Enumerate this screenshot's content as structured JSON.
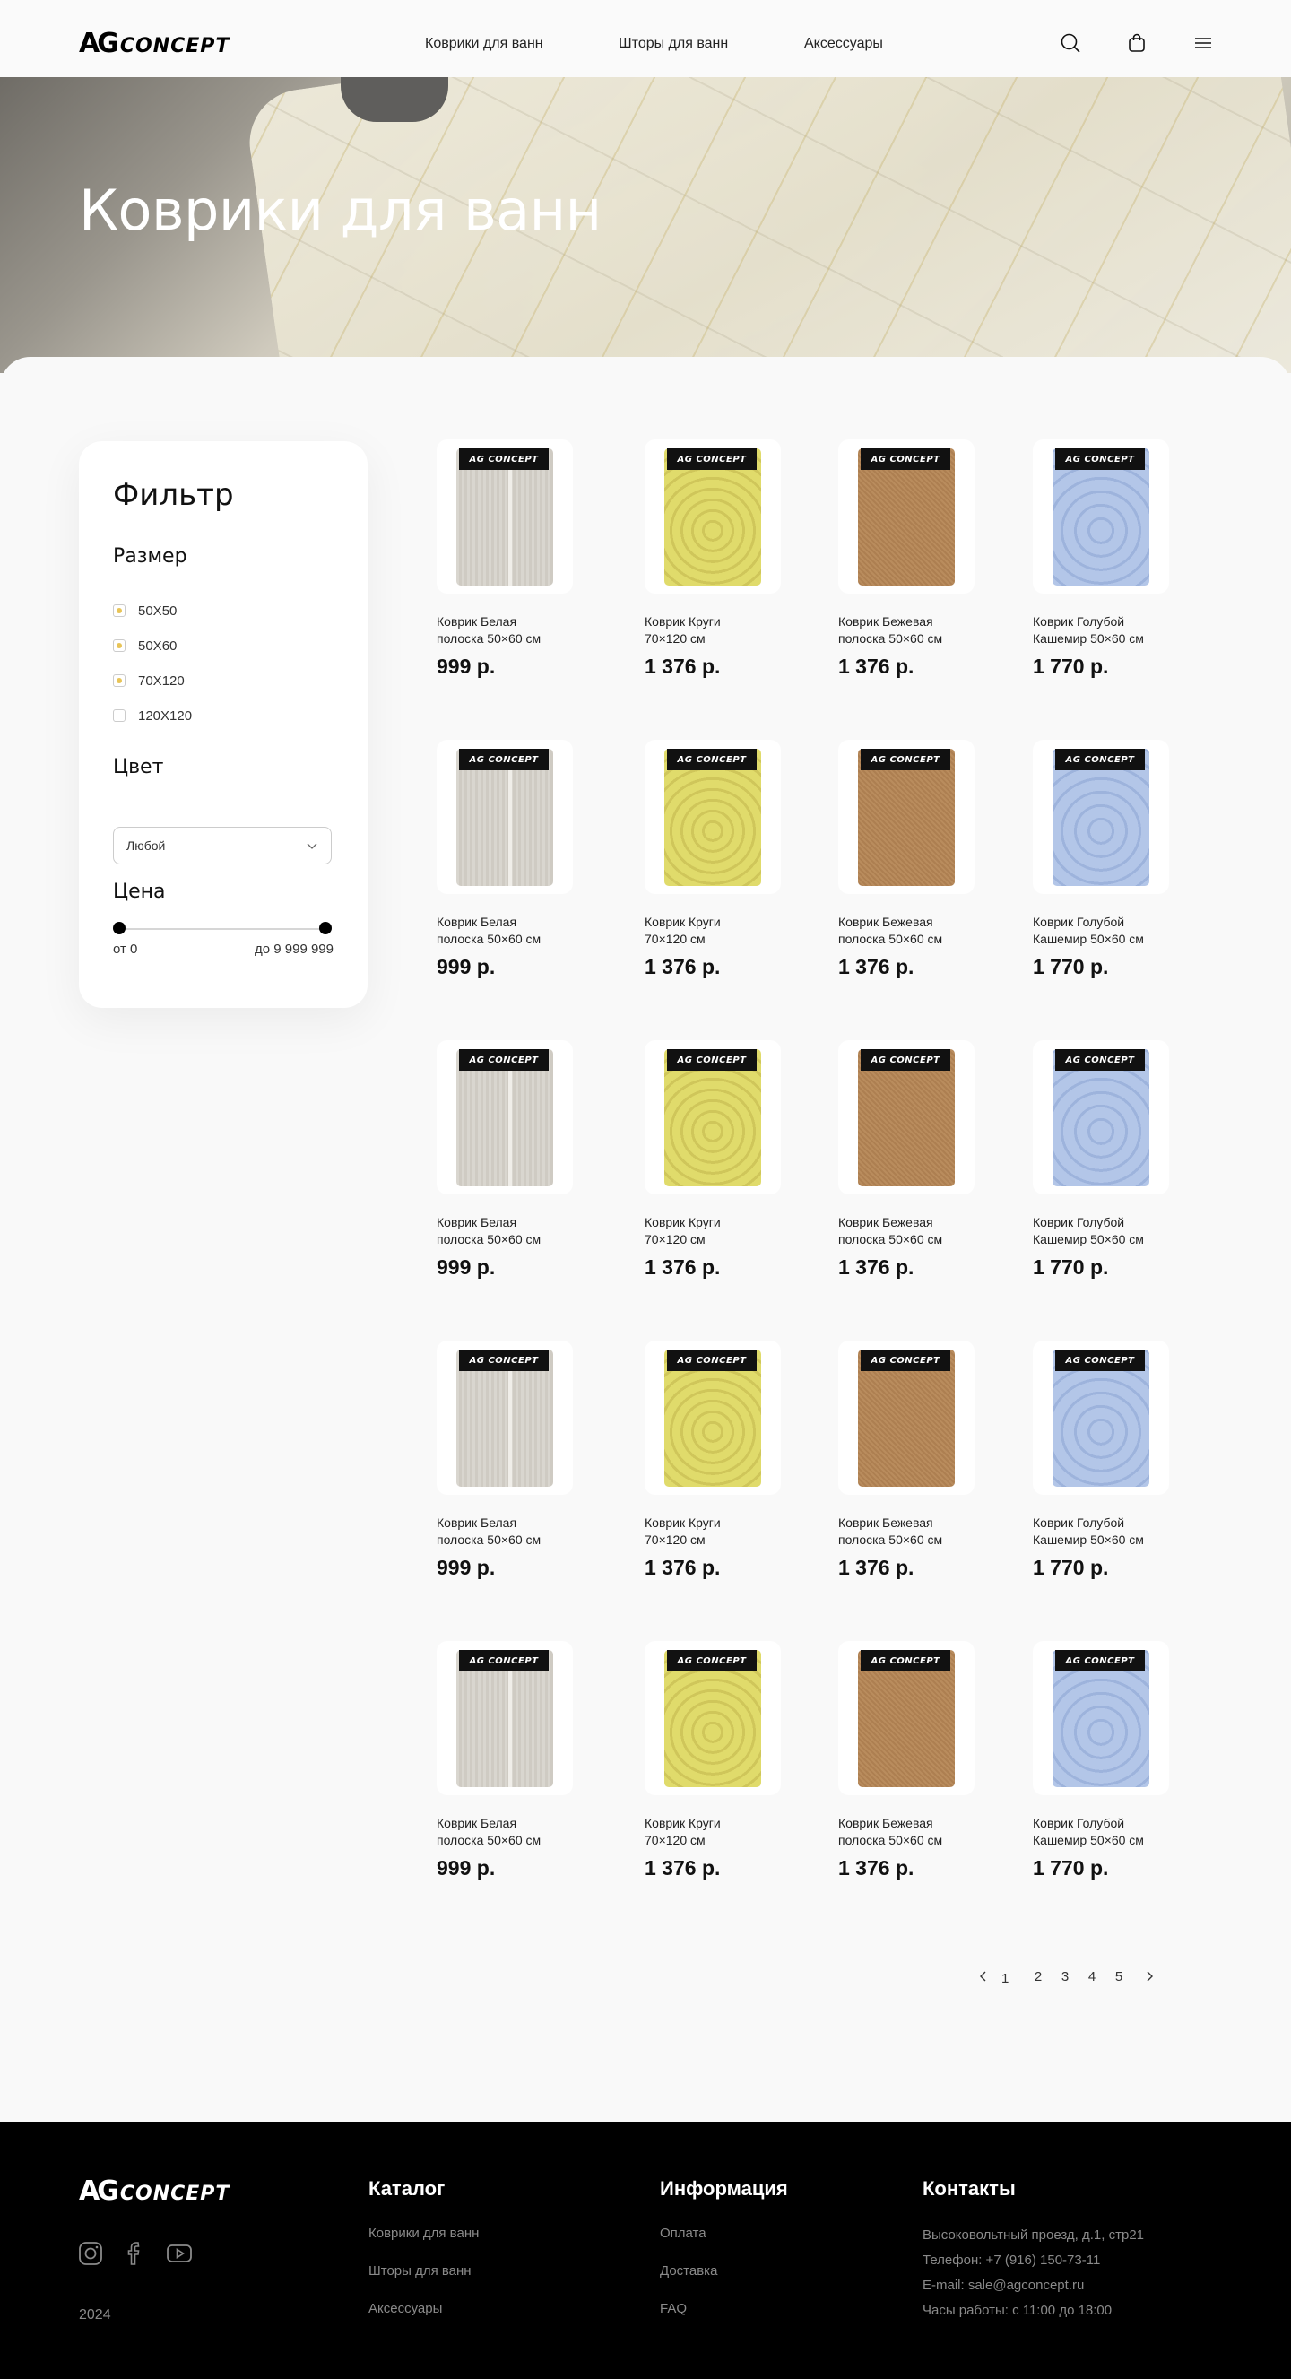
{
  "header": {
    "logo_ag": "AG",
    "logo_rest": "CONCEPT",
    "nav": [
      "Коврики для ванн",
      "Шторы для ванн",
      "Аксессуары"
    ],
    "icons": [
      "search-icon",
      "bag-icon",
      "menu-icon"
    ]
  },
  "hero": {
    "title": "Коврики для ванн"
  },
  "filter": {
    "title": "Фильтр",
    "size_label": "Размер",
    "sizes": [
      {
        "label": "50X50",
        "checked": true
      },
      {
        "label": "50X60",
        "checked": true
      },
      {
        "label": "70X120",
        "checked": true
      },
      {
        "label": "120X120",
        "checked": false
      }
    ],
    "color_label": "Цвет",
    "color_value": "Любой",
    "price_label": "Цена",
    "price_from": "от 0",
    "price_to": "до 9 999 999"
  },
  "products": [
    {
      "name": "Коврик Белая",
      "name2": "полоска 50×60 см",
      "price": "999 р.",
      "tag": "AG CONCEPT"
    },
    {
      "name": "Коврик Круги",
      "name2": "70×120 см",
      "price": "1 376 р.",
      "tag": "AG CONCEPT"
    },
    {
      "name": "Коврик Бежевая",
      "name2": "полоска 50×60 см",
      "price": "1 376 р.",
      "tag": "AG CONCEPT"
    },
    {
      "name": "Коврик Голубой",
      "name2": "Кашемир 50×60 см",
      "price": "1 770 р.",
      "tag": "AG CONCEPT"
    }
  ],
  "pagination": {
    "pages": [
      "1",
      "2",
      "3",
      "4",
      "5"
    ],
    "current": "1"
  },
  "footer": {
    "logo_ag": "AG",
    "logo_rest": "CONCEPT",
    "year": "2024",
    "catalog_title": "Каталог",
    "catalog_links": [
      "Коврики для ванн",
      "Шторы для ванн",
      "Аксессуары"
    ],
    "info_title": "Информация",
    "info_links": [
      "Оплата",
      "Доставка",
      "FAQ"
    ],
    "contacts_title": "Контакты",
    "contacts": [
      "Высоковольтный проезд, д.1,  стр21",
      "Телефон: +7 (916) 150-73-11",
      "E-mail: sale@agconcept.ru",
      "Часы работы:  с 11:00 до 18:00"
    ],
    "social_icons": [
      "instagram-icon",
      "facebook-icon",
      "youtube-icon"
    ]
  },
  "colors": {
    "accent": "#e8c457",
    "footer_bg": "#000000",
    "text": "#111111"
  }
}
